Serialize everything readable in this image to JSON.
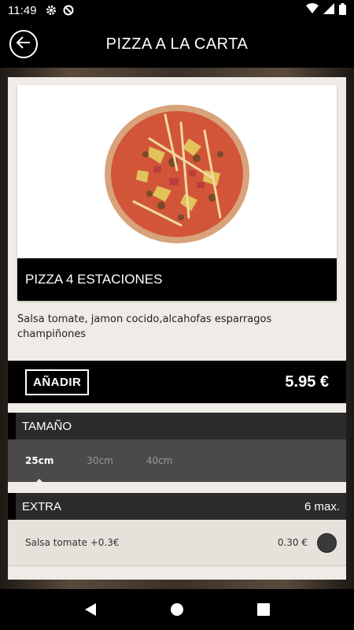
{
  "status_bar": {
    "time": "11:49",
    "icons": [
      "gear-icon",
      "do-not-disturb-icon",
      "wifi-icon",
      "signal-icon",
      "battery-icon"
    ]
  },
  "app_bar": {
    "title": "PIZZA A LA CARTA",
    "back_icon": "arrow-left-icon"
  },
  "product": {
    "name": "PIZZA 4 ESTACIONES",
    "description": "Salsa tomate, jamon cocido,alcahofas esparragos champiñones",
    "add_label": "AÑADIR",
    "price": "5.95 €"
  },
  "size_section": {
    "title": "TAMAÑO",
    "options": [
      {
        "label": "25cm",
        "selected": true
      },
      {
        "label": "30cm",
        "selected": false
      },
      {
        "label": "40cm",
        "selected": false
      }
    ]
  },
  "extra_section": {
    "title": "EXTRA",
    "max_label": "6 max.",
    "items": [
      {
        "label": "Salsa tomate +0.3€",
        "price": "0.30 €"
      }
    ]
  },
  "nav_bar": {
    "icons": [
      "back-triangle-icon",
      "home-circle-icon",
      "recents-square-icon"
    ]
  },
  "colors": {
    "accent": "#000000",
    "card_bg": "#efebe6",
    "section_header": "#2b2b2b",
    "tabs_bg": "#4a4a4a"
  }
}
